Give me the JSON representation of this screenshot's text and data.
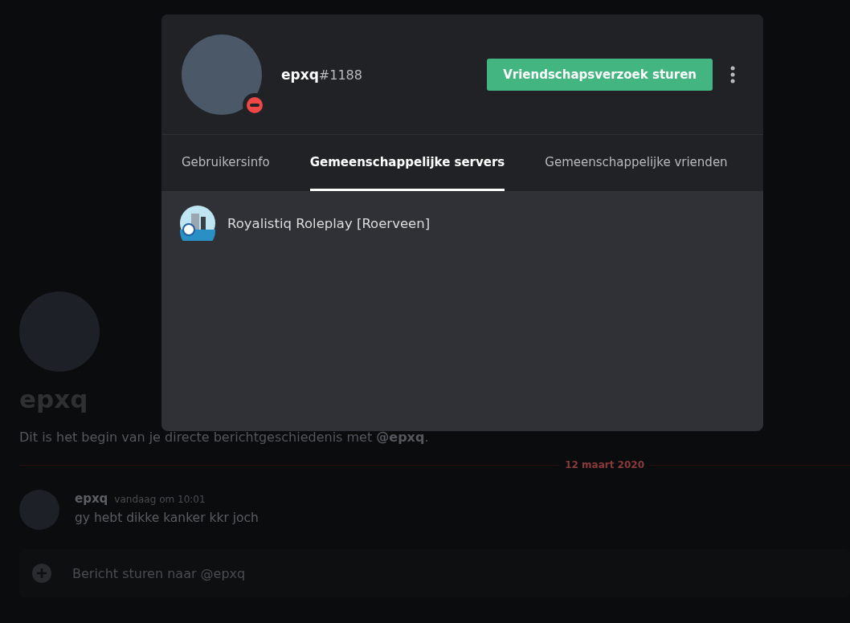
{
  "chat": {
    "heading": "epxq",
    "intro": "Dit is het begin van je directe berichtgeschiedenis met **@epxq**.",
    "divider_date": "12 maart 2020",
    "messages": [
      {
        "author": "epxq",
        "time": "vandaag om 10:01",
        "text": "gy hebt dikke kanker kkr joch"
      }
    ],
    "input": {
      "placeholder": "Bericht sturen naar @epxq"
    }
  },
  "profile": {
    "name": "epxq",
    "discriminator": "#1188",
    "do_not_disturb": true,
    "action_button": "Vriendschapsverzoek sturen",
    "tabs": [
      {
        "label": "Gebruikersinfo",
        "selected": false
      },
      {
        "label": "Gemeenschappelijke servers",
        "selected": true
      },
      {
        "label": "Gemeenschappelijke vrienden",
        "selected": false
      }
    ],
    "servers": [
      {
        "name": "Royalistiq Roleplay [Roerveen]"
      }
    ]
  }
}
